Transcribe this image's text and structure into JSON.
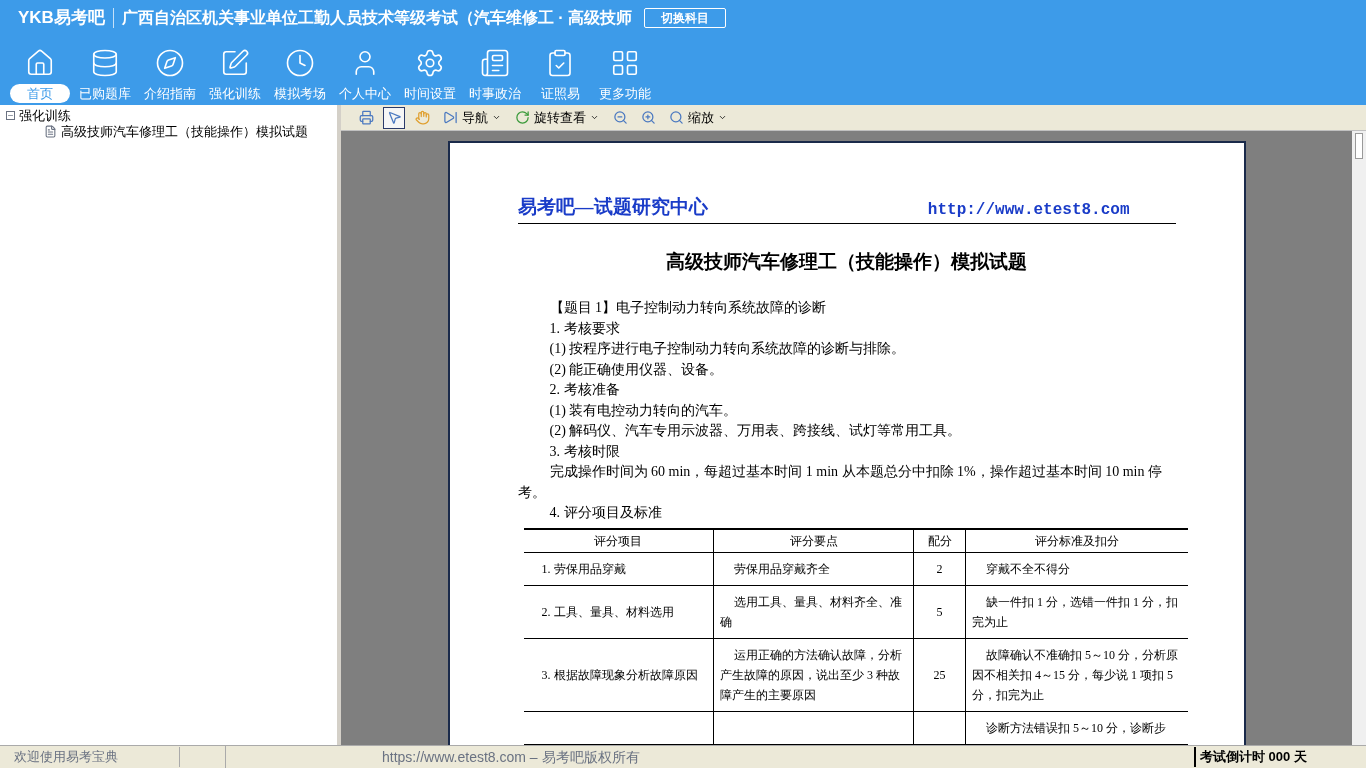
{
  "header": {
    "logo": "YKB易考吧",
    "title": "广西自治区机关事业单位工勤人员技术等级考试（汽车维修工 · 高级技师",
    "switch_button": "切换科目"
  },
  "nav": [
    {
      "label": "首页",
      "selected": true
    },
    {
      "label": "已购题库",
      "selected": false
    },
    {
      "label": "介绍指南",
      "selected": false
    },
    {
      "label": "强化训练",
      "selected": false
    },
    {
      "label": "模拟考场",
      "selected": false
    },
    {
      "label": "个人中心",
      "selected": false
    },
    {
      "label": "时间设置",
      "selected": false
    },
    {
      "label": "时事政治",
      "selected": false
    },
    {
      "label": "证照易",
      "selected": false
    },
    {
      "label": "更多功能",
      "selected": false
    }
  ],
  "tree": [
    {
      "label": "强化训练",
      "expanded": true,
      "children": [
        {
          "label": "高级技师汽车修理工（技能操作）模拟试题"
        }
      ]
    }
  ],
  "toolbar": [
    {
      "kind": "tool",
      "selected": false
    },
    {
      "kind": "tool",
      "selected": true
    },
    {
      "kind": "tool",
      "selected": false
    },
    {
      "kind": "menu",
      "label": "导航"
    },
    {
      "kind": "menu",
      "label": "旋转查看"
    },
    {
      "kind": "tool",
      "selected": false
    },
    {
      "kind": "tool",
      "selected": false
    },
    {
      "kind": "menu",
      "label": "缩放"
    }
  ],
  "document": {
    "brand": "易考吧—试题研究中心",
    "url": "http://www.etest8.com",
    "title": "高级技师汽车修理工（技能操作）模拟试题",
    "paragraphs": [
      "【题目 1】电子控制动力转向系统故障的诊断",
      "1. 考核要求",
      "(1) 按程序进行电子控制动力转向系统故障的诊断与排除。",
      "(2) 能正确使用仪器、设备。",
      "2. 考核准备",
      "(1) 装有电控动力转向的汽车。",
      "(2) 解码仪、汽车专用示波器、万用表、跨接线、试灯等常用工具。",
      "3. 考核时限",
      "完成操作时间为 60 min，每超过基本时间 1 min 从本题总分中扣除 1%，操作超过基本时间 10 min 停考。",
      "4. 评分项目及标准"
    ],
    "table": {
      "columns": [
        "评分项目",
        "评分要点",
        "配分",
        "评分标准及扣分"
      ],
      "rows": [
        [
          "1. 劳保用品穿戴",
          "劳保用品穿戴齐全",
          "2",
          "穿戴不全不得分"
        ],
        [
          "2. 工具、量具、材料选用",
          "选用工具、量具、材料齐全、准确",
          "5",
          "缺一件扣 1 分，选错一件扣 1 分，扣完为止"
        ],
        [
          "3. 根据故障现象分析故障原因",
          "运用正确的方法确认故障，分析产生故障的原因，说出至少 3 种故障产生的主要原因",
          "25",
          "故障确认不准确扣 5～10 分，分析原因不相关扣 4～15 分，每少说 1 项扣 5 分，扣完为止"
        ],
        [
          "",
          "",
          "",
          "诊断方法错误扣 5～10 分，诊断步"
        ]
      ]
    }
  },
  "status_bar": {
    "welcome": "欢迎使用易考宝典",
    "copyright": "https://www.etest8.com – 易考吧版权所有",
    "countdown": "考试倒计时 000 天"
  }
}
